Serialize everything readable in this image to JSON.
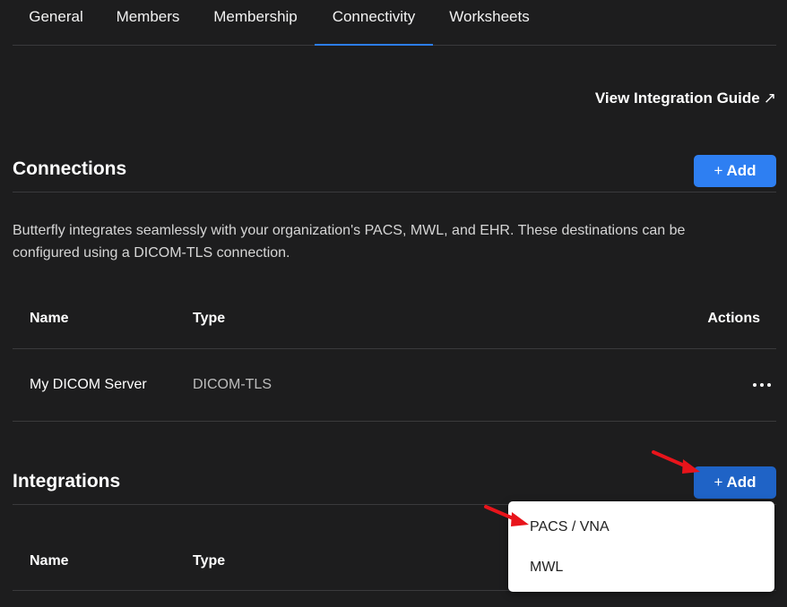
{
  "tabs": [
    {
      "label": "General"
    },
    {
      "label": "Members"
    },
    {
      "label": "Membership"
    },
    {
      "label": "Connectivity"
    },
    {
      "label": "Worksheets"
    }
  ],
  "active_tab": "Connectivity",
  "guide_link": {
    "label": "View Integration Guide",
    "icon": "external-arrow-icon"
  },
  "connections": {
    "title": "Connections",
    "add_label": "Add",
    "description": "Butterfly integrates seamlessly with your organization's PACS, MWL, and EHR. These destinations can be configured using a DICOM-TLS connection.",
    "columns": {
      "name": "Name",
      "type": "Type",
      "actions": "Actions"
    },
    "rows": [
      {
        "name": "My DICOM Server",
        "type": "DICOM-TLS"
      }
    ]
  },
  "integrations": {
    "title": "Integrations",
    "add_label": "Add",
    "columns": {
      "name": "Name",
      "type": "Type"
    },
    "menu_items": [
      {
        "label": "PACS / VNA"
      },
      {
        "label": "MWL"
      }
    ]
  },
  "colors": {
    "background": "#1d1d1e",
    "accent": "#2e7ff2",
    "annotation_arrow": "#e8141b"
  }
}
